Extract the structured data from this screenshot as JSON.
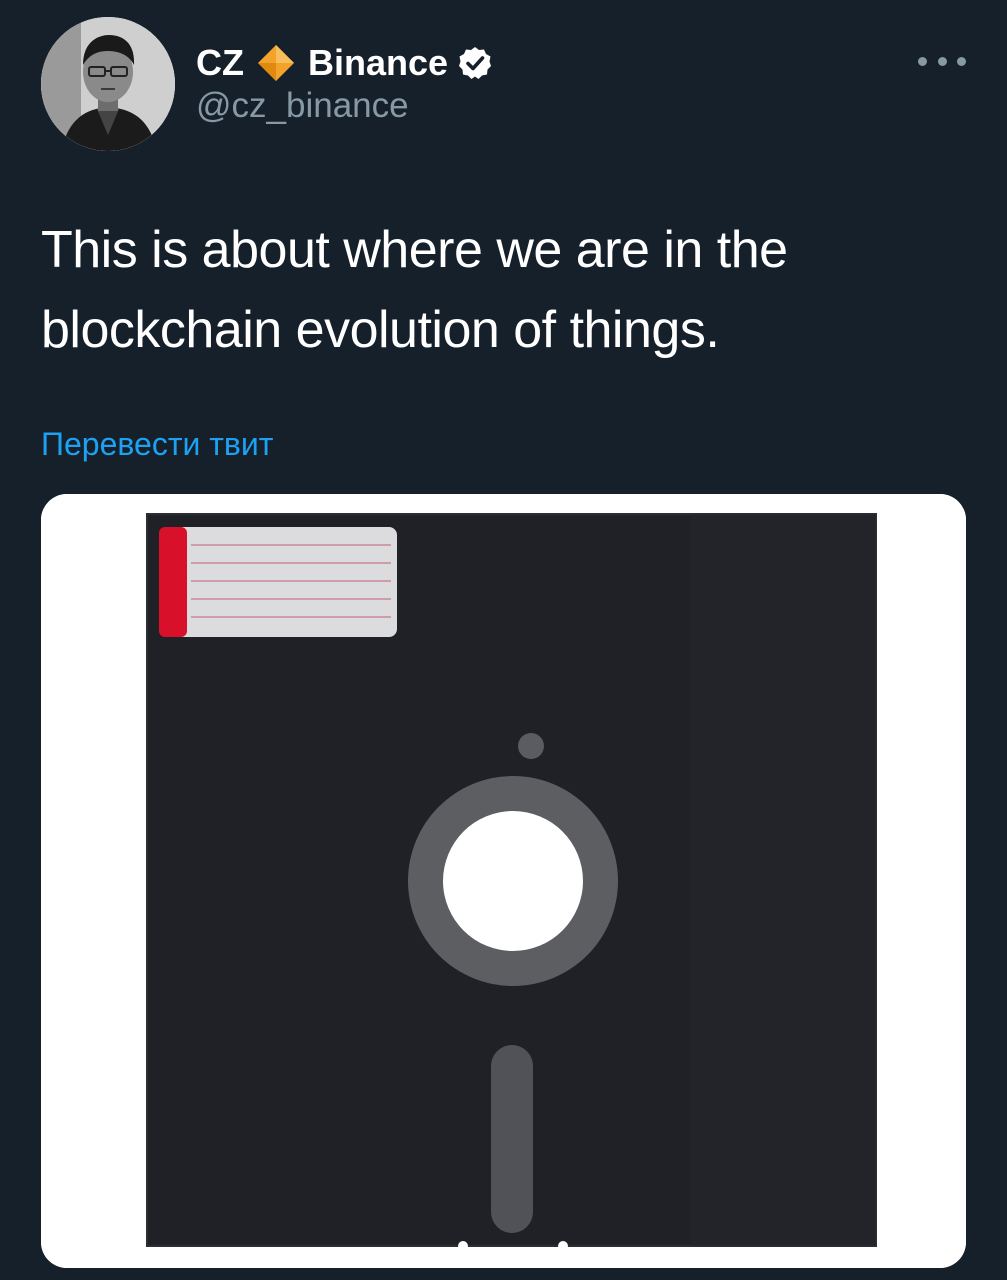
{
  "tweet": {
    "author": {
      "display_name": "CZ",
      "affiliation": "Binance",
      "handle": "@cz_binance",
      "badge_icon": "binance-diamond-icon",
      "verified_icon": "verified-badge-icon"
    },
    "text": "This is about where we are in the blockchain evolution of things.",
    "translate_label": "Перевести твит",
    "menu_icon": "more-options-icon"
  },
  "colors": {
    "background": "#15202b",
    "text": "#ffffff",
    "secondary_text": "#8899a6",
    "link": "#1da1f2",
    "diamond": "#f3a32b",
    "disk": "#1e2026",
    "label_stripe": "#d8102a"
  }
}
